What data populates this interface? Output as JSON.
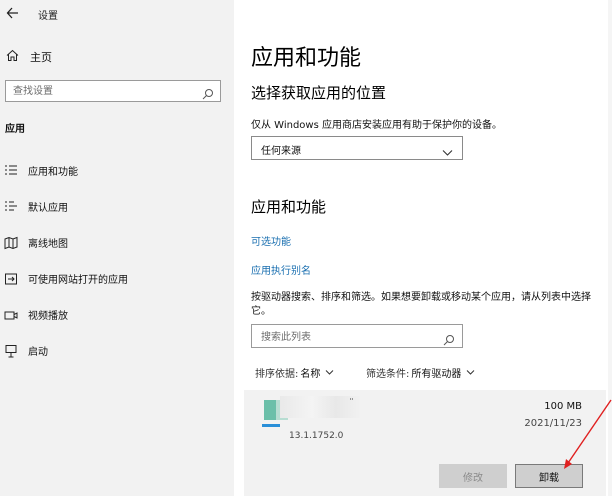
{
  "window": {
    "title": "设置",
    "back_icon": "back-arrow-icon"
  },
  "sidebar": {
    "home_label": "主页",
    "search_placeholder": "查找设置",
    "section": "应用",
    "items": [
      {
        "label": "应用和功能",
        "icon": "apps-list-icon"
      },
      {
        "label": "默认应用",
        "icon": "default-apps-icon"
      },
      {
        "label": "离线地图",
        "icon": "map-icon"
      },
      {
        "label": "可使用网站打开的应用",
        "icon": "web-app-icon"
      },
      {
        "label": "视频播放",
        "icon": "video-icon"
      },
      {
        "label": "启动",
        "icon": "startup-icon"
      }
    ]
  },
  "main": {
    "title": "应用和功能",
    "source_heading": "选择获取应用的位置",
    "source_desc": "仅从 Windows 应用商店安装应用有助于保护你的设备。",
    "source_value": "任何来源",
    "apps_heading": "应用和功能",
    "optional_features": "可选功能",
    "app_alias": "应用执行别名",
    "search_desc": "按驱动器搜索、排序和筛选。如果想要卸载或移动某个应用，请从列表中选择它。",
    "search_placeholder": "搜索此列表",
    "sort_label": "排序依据:",
    "sort_value": "名称",
    "filter_label": "筛选条件:",
    "filter_value": "所有驱动器",
    "app": {
      "name_tail": "̈",
      "version": "13.1.1752.0",
      "size": "100 MB",
      "date": "2021/11/23",
      "modify_label": "修改",
      "uninstall_label": "卸载"
    }
  },
  "colors": {
    "link": "#1a6fb0",
    "sidebar_bg": "#f2f2f2",
    "annotation_arrow": "#e02020"
  }
}
